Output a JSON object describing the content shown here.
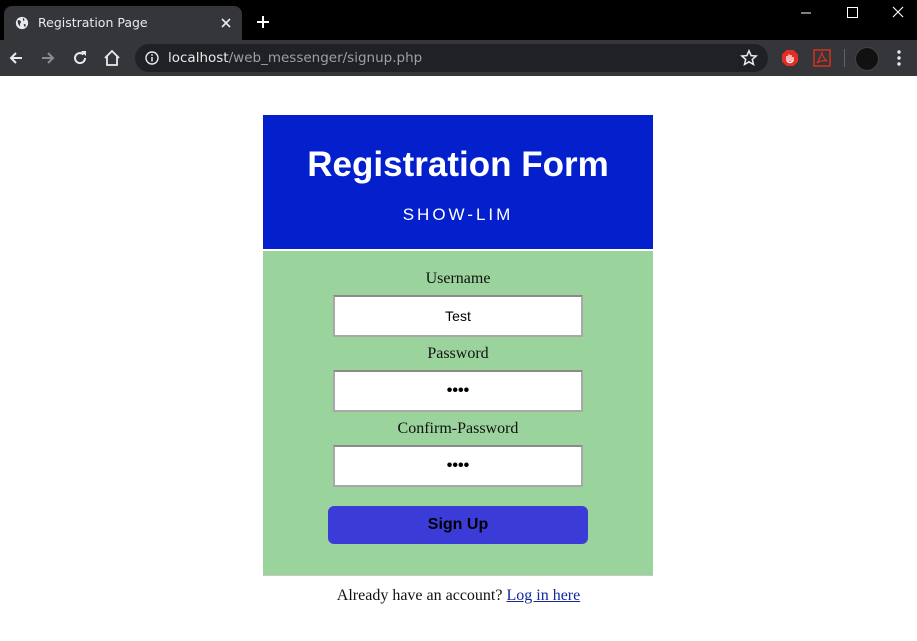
{
  "browser": {
    "tab_title": "Registration Page",
    "url_host": "localhost",
    "url_path": "/web_messenger/signup.php"
  },
  "form": {
    "title": "Registration Form",
    "subtitle": "SHOW-LIM",
    "username_label": "Username",
    "username_value": "Test",
    "password_label": "Password",
    "password_value": "••••",
    "confirm_label": "Confirm-Password",
    "confirm_value": "••••",
    "submit_label": "Sign Up"
  },
  "footer": {
    "text": "Already have an account?",
    "link": "Log in here"
  },
  "colors": {
    "header": "#0320cc",
    "body": "#9bd39d",
    "button": "#3b3bd8"
  }
}
